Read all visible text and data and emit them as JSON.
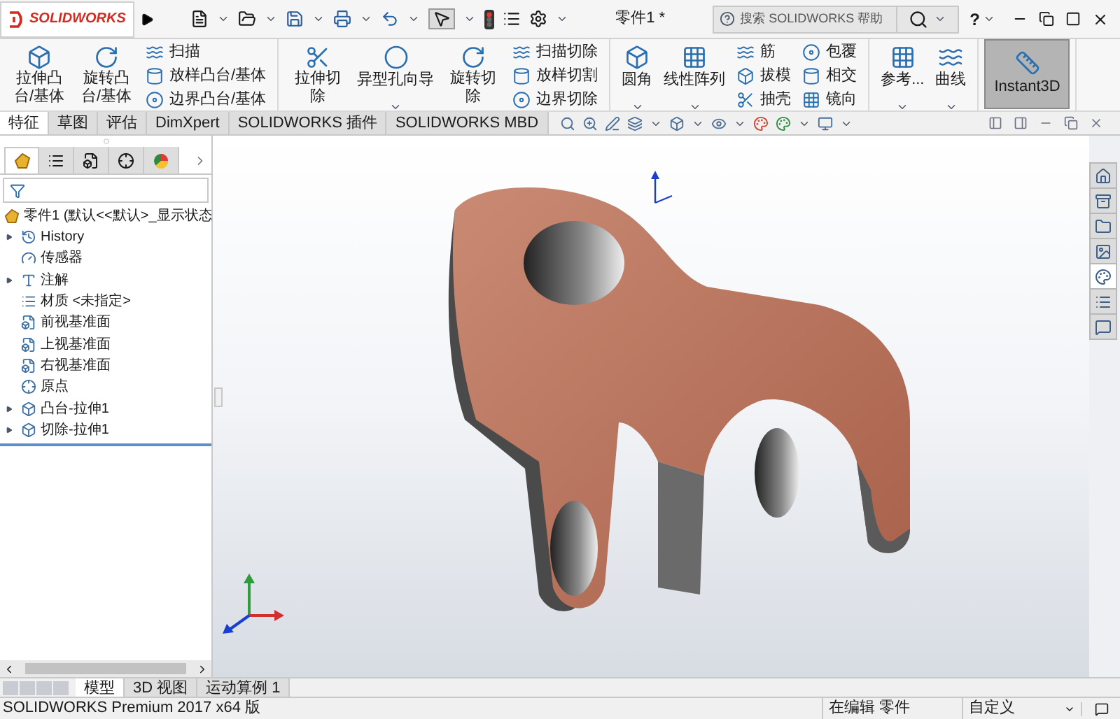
{
  "titlebar": {
    "logo": "SOLIDWORKS",
    "title": "零件1 *",
    "search": {
      "placeholder": "搜索 SOLIDWORKS 帮助"
    },
    "help": "?"
  },
  "ribbon": {
    "groups": [
      {
        "items": [
          {
            "kind": "button",
            "label": "拉伸凸台/基体"
          },
          {
            "kind": "button",
            "label": "旋转凸台/基体"
          },
          {
            "kind": "stack",
            "entries": [
              {
                "label": "扫描"
              },
              {
                "label": "放样凸台/基体"
              },
              {
                "label": "边界凸台/基体"
              }
            ]
          }
        ]
      },
      {
        "items": [
          {
            "kind": "button",
            "label": "拉伸切除"
          },
          {
            "kind": "dropdown",
            "label": "异型孔向导"
          },
          {
            "kind": "button",
            "label": "旋转切除"
          },
          {
            "kind": "stack",
            "entries": [
              {
                "label": "扫描切除"
              },
              {
                "label": "放样切割"
              },
              {
                "label": "边界切除"
              }
            ]
          }
        ]
      },
      {
        "items": [
          {
            "kind": "dropdown",
            "label": "圆角"
          },
          {
            "kind": "dropdown",
            "label": "线性阵列"
          },
          {
            "kind": "stack",
            "entries": [
              {
                "label": "筋"
              },
              {
                "label": "拔模"
              },
              {
                "label": "抽壳"
              }
            ]
          },
          {
            "kind": "stack",
            "entries": [
              {
                "label": "包覆"
              },
              {
                "label": "相交"
              },
              {
                "label": "镜向"
              }
            ]
          }
        ]
      },
      {
        "items": [
          {
            "kind": "dropdown",
            "label": "参考..."
          },
          {
            "kind": "dropdown",
            "label": "曲线"
          }
        ]
      },
      {
        "items": [
          {
            "kind": "toggle",
            "label": "Instant3D",
            "selected": true
          }
        ]
      }
    ]
  },
  "tabs": [
    {
      "label": "特征",
      "selected": true
    },
    {
      "label": "草图",
      "selected": false
    },
    {
      "label": "评估",
      "selected": false
    },
    {
      "label": "DimXpert",
      "selected": false
    },
    {
      "label": "SOLIDWORKS 插件",
      "selected": false
    },
    {
      "label": "SOLIDWORKS MBD",
      "selected": false
    }
  ],
  "tree": {
    "root": "零件1  (默认<<默认>_显示状态",
    "items": [
      {
        "label": "History",
        "expandable": true
      },
      {
        "label": "传感器",
        "expandable": false
      },
      {
        "label": "注解",
        "expandable": true
      },
      {
        "label": "材质 <未指定>",
        "expandable": false
      },
      {
        "label": "前视基准面",
        "expandable": false
      },
      {
        "label": "上视基准面",
        "expandable": false
      },
      {
        "label": "右视基准面",
        "expandable": false
      },
      {
        "label": "原点",
        "expandable": false
      },
      {
        "label": "凸台-拉伸1",
        "expandable": true
      },
      {
        "label": "切除-拉伸1",
        "expandable": true
      }
    ]
  },
  "task_pane": [
    {
      "selected": false
    },
    {
      "selected": false
    },
    {
      "selected": false
    },
    {
      "selected": false
    },
    {
      "selected": true
    },
    {
      "selected": false
    },
    {
      "selected": false
    }
  ],
  "bottom_tabs": [
    {
      "label": "模型",
      "selected": true
    },
    {
      "label": "3D 视图",
      "selected": false
    },
    {
      "label": "运动算例 1",
      "selected": false
    }
  ],
  "status_bar": {
    "product": "SOLIDWORKS Premium 2017 x64 版",
    "mode": "在编辑 零件",
    "units": "自定义"
  }
}
